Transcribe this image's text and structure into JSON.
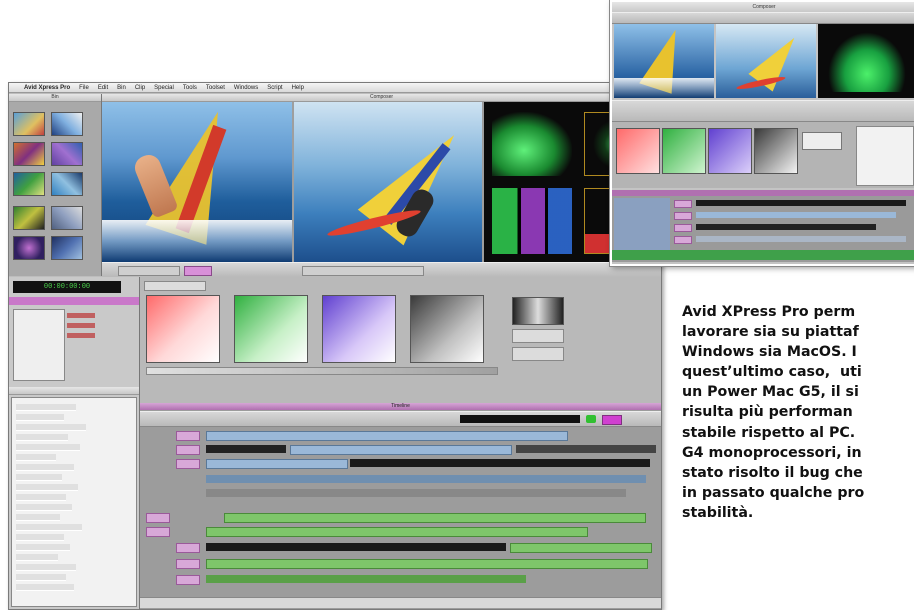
{
  "main_window": {
    "menu": [
      "Avid Xpress Pro",
      "File",
      "Edit",
      "Bin",
      "Clip",
      "Special",
      "Tools",
      "Toolset",
      "Windows",
      "Script",
      "Help"
    ],
    "bin_title": "Bin",
    "composer_title": "Composer",
    "timecode": "00:00:00:00",
    "timeline_title": "Timeline"
  },
  "inset_window": {
    "composer_title": "Composer"
  },
  "colors": {
    "avid_purple": "#c978c9",
    "timeline_blue": "#9ab8d8",
    "timeline_green": "#7ec66a",
    "scope_green": "#33dd55"
  },
  "caption": {
    "lines": [
      "Avid XPress Pro perm",
      "lavorare sia su piattaf",
      "Windows sia MacOS. I",
      "quest’ultimo caso,  uti",
      "un Power Mac G5, il si",
      "risulta più performan",
      "stabile rispetto al PC.",
      "G4 monoprocessori, in",
      "stato risolto il bug che",
      "in passato qualche pro",
      "stabilità."
    ]
  }
}
